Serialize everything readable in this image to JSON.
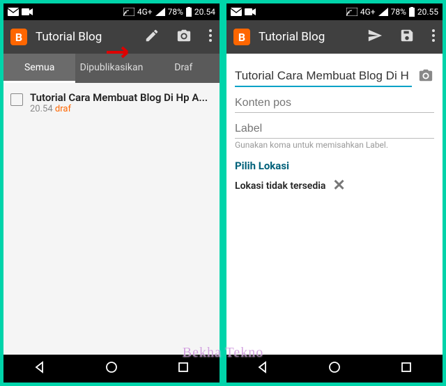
{
  "left": {
    "status": {
      "time": "20.54",
      "battery": "78%",
      "net": "4G+"
    },
    "app_title": "Tutorial Blog",
    "tabs": [
      "Semua",
      "Dipublikasikan",
      "Draf"
    ],
    "active_tab": 0,
    "post": {
      "title": "Tutorial Cara Membuat Blog Di Hp A...",
      "time": "20.54",
      "status": "draf"
    }
  },
  "right": {
    "status": {
      "time": "20.55",
      "battery": "78%",
      "net": "4G+"
    },
    "app_title": "Tutorial Blog",
    "editor": {
      "title_value": "Tutorial Cara Membuat Blog Di H",
      "content_placeholder": "Konten pos",
      "label_placeholder": "Label",
      "label_hint": "Gunakan koma untuk memisahkan Label.",
      "location_heading": "Pilih Lokasi",
      "location_status": "Lokasi tidak tersedia"
    }
  },
  "watermark": "Bekha Tekno"
}
